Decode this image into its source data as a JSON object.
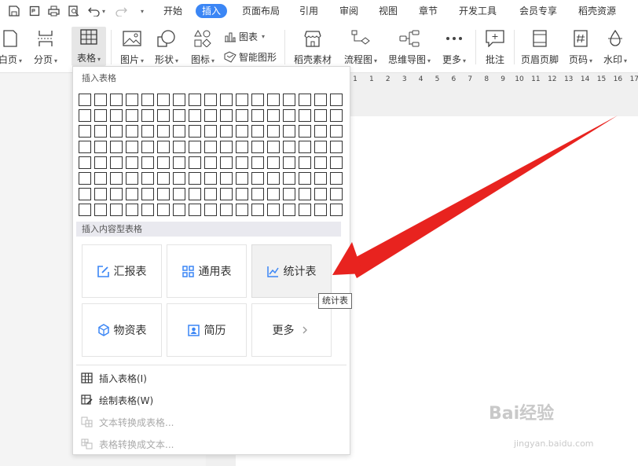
{
  "tabs": [
    {
      "label": "开始",
      "active": false
    },
    {
      "label": "插入",
      "active": true
    },
    {
      "label": "页面布局",
      "active": false
    },
    {
      "label": "引用",
      "active": false
    },
    {
      "label": "审阅",
      "active": false
    },
    {
      "label": "视图",
      "active": false
    },
    {
      "label": "章节",
      "active": false
    },
    {
      "label": "开发工具",
      "active": false
    },
    {
      "label": "会员专享",
      "active": false
    },
    {
      "label": "稻壳资源",
      "active": false
    }
  ],
  "ribbon": {
    "blank_page": "白页",
    "page_break": "分页",
    "table": "表格",
    "picture": "图片",
    "shape": "形状",
    "icon": "图标",
    "chart": "图表",
    "smart_art": "智能图形",
    "docer_material": "稻壳素材",
    "flowchart": "流程图",
    "mindmap": "思维导图",
    "more": "更多",
    "comment": "批注",
    "header_footer": "页眉页脚",
    "page_number": "页码",
    "watermark": "水印"
  },
  "ruler": [
    "1",
    "1",
    "2",
    "3",
    "4",
    "5",
    "6",
    "7",
    "8",
    "9",
    "10",
    "11",
    "12",
    "13",
    "14",
    "15",
    "16",
    "17"
  ],
  "dropdown": {
    "insert_table_title": "插入表格",
    "grid": {
      "rows": 8,
      "cols": 17
    },
    "content_tables_title": "插入内容型表格",
    "templates": [
      {
        "label": "汇报表",
        "icon": "edit-icon"
      },
      {
        "label": "通用表",
        "icon": "grid-icon"
      },
      {
        "label": "统计表",
        "icon": "trend-icon"
      },
      {
        "label": "物资表",
        "icon": "cube-icon"
      },
      {
        "label": "简历",
        "icon": "person-card-icon"
      },
      {
        "label": "更多",
        "icon": "chevron-right-icon"
      }
    ],
    "menu": [
      {
        "label": "插入表格(I)",
        "enabled": true
      },
      {
        "label": "绘制表格(W)",
        "enabled": true
      },
      {
        "label": "文本转换成表格...",
        "enabled": false
      },
      {
        "label": "表格转换成文本...",
        "enabled": false
      }
    ]
  },
  "tooltip": "统计表",
  "watermark": {
    "brand": "Bai经验",
    "url": "jingyan.baidu.com"
  },
  "colors": {
    "accent": "#3b86f5",
    "arrow": "#e8231f"
  }
}
